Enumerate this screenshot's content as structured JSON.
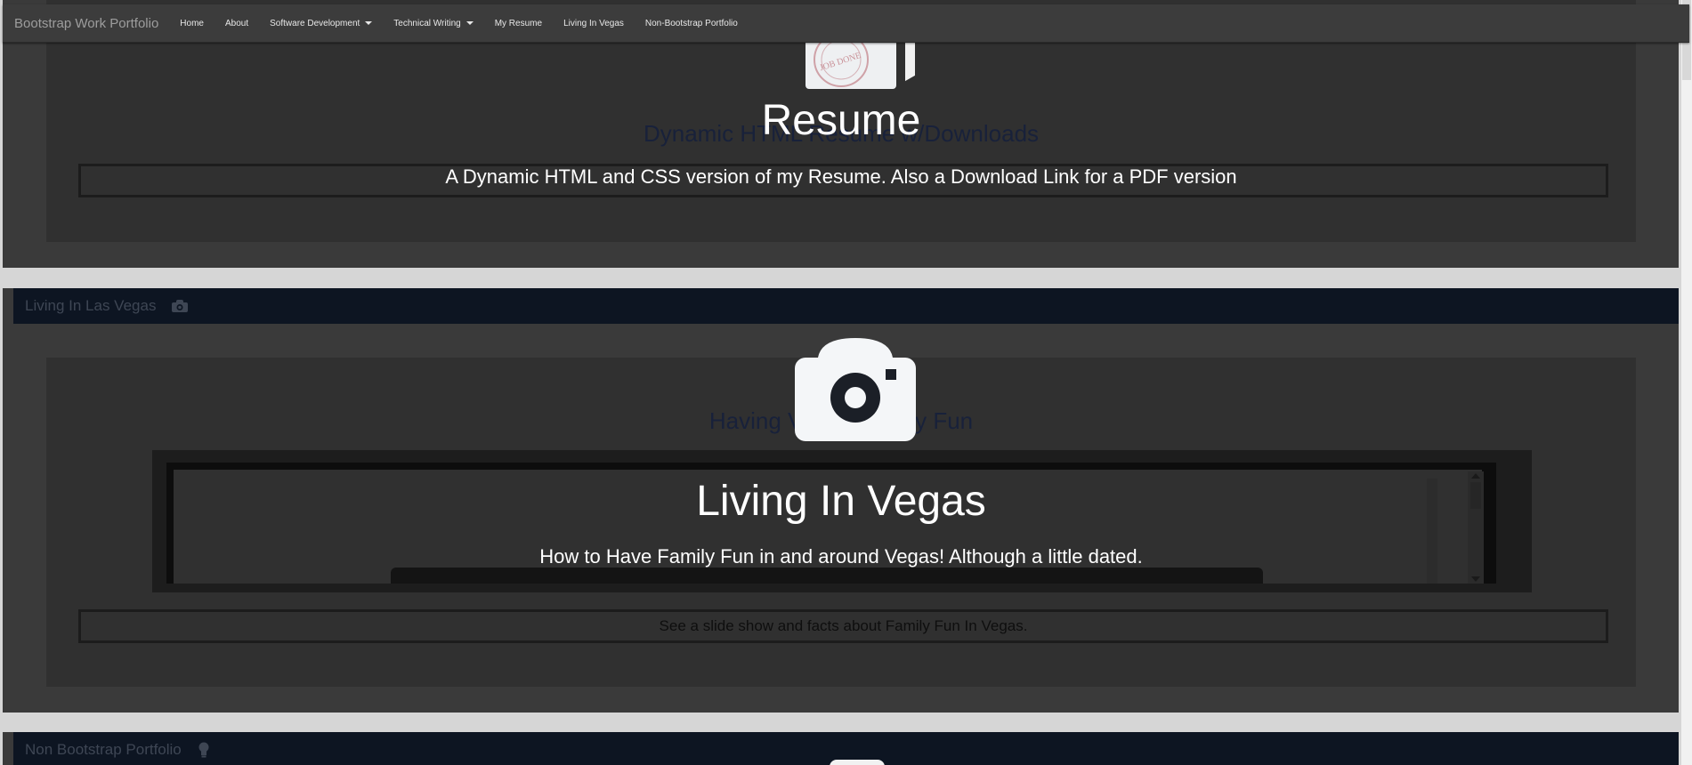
{
  "navbar": {
    "brand": "Bootstrap Work Portfolio",
    "items": [
      {
        "label": "Home"
      },
      {
        "label": "About"
      },
      {
        "label": "Software Development",
        "dropdown": true
      },
      {
        "label": "Technical Writing",
        "dropdown": true
      },
      {
        "label": "My Resume"
      },
      {
        "label": "Living In Vegas"
      },
      {
        "label": "Non-Bootstrap Portfolio"
      }
    ]
  },
  "resume_section": {
    "heading": "Dynamic HTML Resume w/Downloads",
    "overlay_title": "Resume",
    "overlay_description": "A Dynamic HTML and CSS version of my Resume. Also a Download Link for a PDF version",
    "image_stamp_text": "JOB DONE"
  },
  "vegas_section": {
    "header_title": "Living In Las Vegas",
    "header_icon": "camera-icon",
    "heading": "Having Vegas Family Fun",
    "overlay_title": "Living In Vegas",
    "overlay_description": "How to Have Family Fun in and around Vegas!  Although a little dated.",
    "caption": "See a slide show and facts about Family Fun In Vegas."
  },
  "nonbootstrap_section": {
    "header_title": "Non Bootstrap Portfolio",
    "header_icon": "lightbulb-icon"
  },
  "colors": {
    "navbar_bg": "#3c3c3c",
    "section_header_bg": "#0d1522",
    "overlay_text": "#ffffff"
  }
}
